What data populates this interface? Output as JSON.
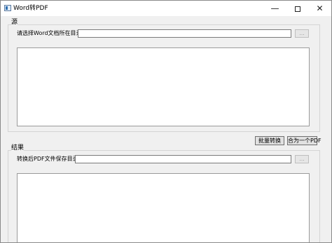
{
  "window": {
    "title": "Word转PDF",
    "controls": {
      "minimize": "—",
      "maximize": "",
      "close": "✕"
    }
  },
  "source": {
    "group_label": "源",
    "dir_label": "请选择Word文档所在目录：",
    "dir_value": "",
    "browse_label": "..."
  },
  "actions": {
    "batch_convert": "批量转换",
    "merge_pdf": "合为一个PDF"
  },
  "result": {
    "group_label": "结果",
    "dir_label": "转换后PDF文件保存目录：",
    "dir_value": "",
    "browse_label": "..."
  }
}
